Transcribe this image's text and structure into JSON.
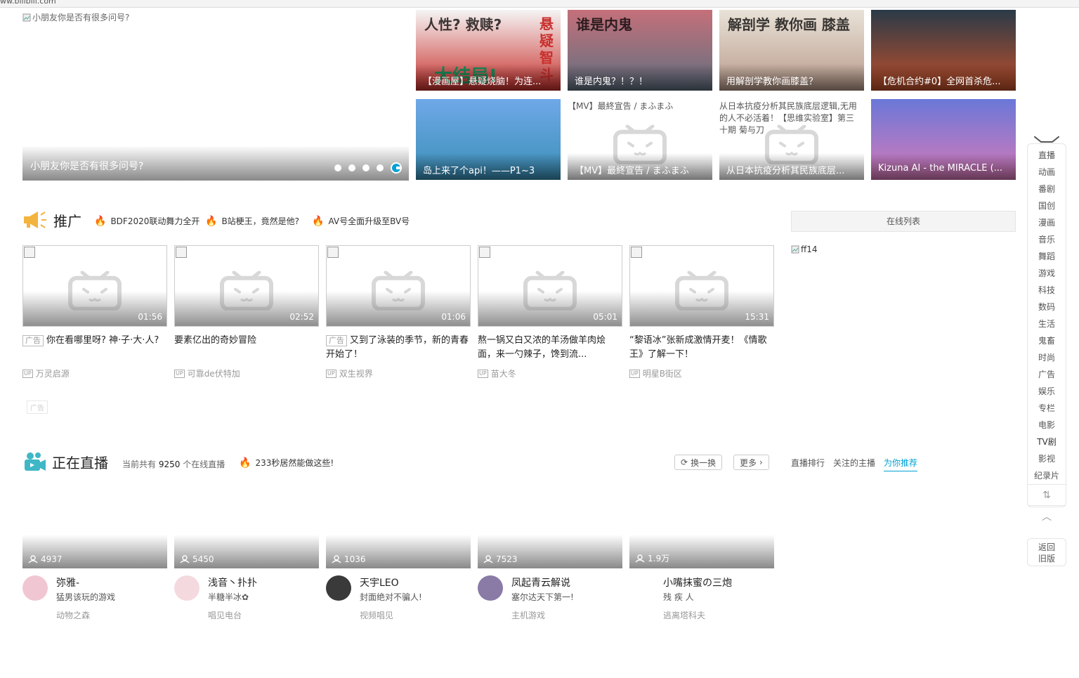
{
  "address": {
    "url": "ww.bilibili.com"
  },
  "hero": {
    "alt": "小朋友你是否有很多问号?",
    "caption": "小朋友你是否有很多问号?",
    "dots": 5
  },
  "tiles": [
    {
      "label": "【漫画屋】悬疑烧脑！为连...",
      "bg_top": "#f5f5f5",
      "bg_bottom": "#c8302c",
      "overlay_text": "人性? 救赎?",
      "overlay_text2": "悬疑智斗",
      "overlay_text3": "大结局!"
    },
    {
      "label": "谁是内鬼？！？！",
      "bg_top": "#c4707a",
      "bg_bottom": "#607080",
      "overlay_text": "谁是内鬼"
    },
    {
      "label": "用解剖学教你画膝盖？",
      "bg_top": "#e9e2d8",
      "bg_bottom": "#b89a8a",
      "overlay_text": "解剖学 教你画 膝盖"
    },
    {
      "label": "【危机合约#0】全网首杀危...",
      "bg_top": "#2a3a48",
      "bg_bottom": "#c0502a"
    },
    {
      "label": "岛上来了个api！——P1~3",
      "bg_top": "#6fa8e8",
      "bg_bottom": "#3a8fb6"
    },
    {
      "label": "【MV】最終宣告 / まふまふ",
      "alt": "【MV】最終宣告 / まふまふ"
    },
    {
      "label": "从日本抗疫分析其民族底层...",
      "alt": "从日本抗疫分析其民族底层逻辑,无用的人不必活着！【思维实验室】第三十期 菊与刀"
    },
    {
      "label": "Kizuna AI - the MIRACLE (...",
      "bg_top": "#6a78d8",
      "bg_bottom": "#d87ab8"
    }
  ],
  "promo": {
    "title": "推广",
    "hots": [
      "BDF2020联动舞力全开",
      "B站梗王，竟然是他?",
      "AV号全面升级至BV号"
    ],
    "cards": [
      {
        "duration": "01:56",
        "ad": "广告",
        "title": "你在看哪里呀? 神·子·大·人?",
        "up": "万灵启源"
      },
      {
        "duration": "02:52",
        "ad": "",
        "title": "要素亿出的奇妙冒险",
        "up": "可靠de伏特加"
      },
      {
        "duration": "01:06",
        "ad": "广告",
        "title": "又到了泳装的季节，新的青春开始了！",
        "up": "双生视界"
      },
      {
        "duration": "05:01",
        "ad": "",
        "title": "熬一锅又白又浓的羊汤做羊肉烩面，来一勺辣子，馋到流...",
        "up": "苗大冬"
      },
      {
        "duration": "15:31",
        "ad": "",
        "title": "“黎语冰”张新成激情开麦！《情歌王》了解一下！",
        "up": "明星B街区"
      }
    ],
    "ad_tag": "广告",
    "online_list": "在线列表",
    "broken_img_alt": "ff14",
    "up_tag": "UP"
  },
  "live": {
    "title": "正在直播",
    "count_prefix": "当前共有",
    "count": "9250",
    "count_suffix": "个在线直播",
    "hot": "233秒居然能做这些!",
    "refresh": "换一换",
    "more": "更多",
    "tabs": [
      "直播排行",
      "关注的主播",
      "为你推荐"
    ],
    "cards": [
      {
        "viewers": "4937",
        "name": "弥雅-",
        "desc": "猛男该玩的游戏",
        "cat": "动物之森",
        "avatar_color": "#f1c6d3"
      },
      {
        "viewers": "5450",
        "name": "浅音丶扑扑",
        "desc": "半糖半冰✿",
        "cat": "唱见电台",
        "avatar_color": "#f4d9de"
      },
      {
        "viewers": "1036",
        "name": "天宇LEO",
        "desc": "封面绝对不骗人!",
        "cat": "视频唱见",
        "avatar_color": "#3a3a3a"
      },
      {
        "viewers": "7523",
        "name": "凤起青云解说",
        "desc": "塞尔达天下第一!",
        "cat": "主机游戏",
        "avatar_color": "#8a7aa6"
      },
      {
        "viewers": "1.9万",
        "name": "小嘴抹蜜の三炮",
        "desc": "残 疾 人",
        "cat": "逃离塔科夫",
        "avatar_color": "#ffffff"
      }
    ]
  },
  "sidenav": {
    "items": [
      "直播",
      "动画",
      "番剧",
      "国创",
      "漫画",
      "音乐",
      "舞蹈",
      "游戏",
      "科技",
      "数码",
      "生活",
      "鬼畜",
      "时尚",
      "广告",
      "娱乐",
      "专栏",
      "电影",
      "TV剧",
      "影视",
      "纪录片"
    ],
    "back_old": [
      "返回",
      "旧版"
    ]
  },
  "colors": {
    "accent": "#00a1d6",
    "fire": "#f25d3c"
  }
}
